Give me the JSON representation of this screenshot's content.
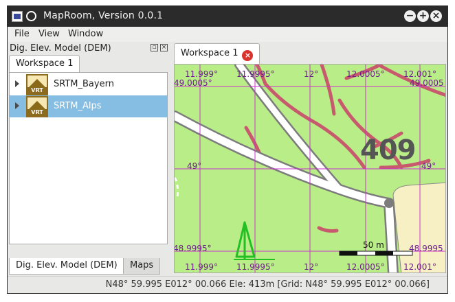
{
  "window": {
    "title": "MapRoom, Version 0.0.1",
    "buttons": [
      "−",
      "+",
      "×"
    ]
  },
  "menu": [
    "File",
    "View",
    "Window"
  ],
  "layers_panel": {
    "title": "Dig. Elev. Model (DEM)",
    "tab": "Workspace 1",
    "layers": [
      {
        "label": "SRTM_Bayern",
        "icon_text": "VRT",
        "selected": false
      },
      {
        "label": "SRTM_Alps",
        "icon_text": "VRT",
        "selected": true
      }
    ],
    "bottom_tabs": [
      "Dig. Elev. Model (DEM)",
      "Maps"
    ]
  },
  "workspace": {
    "tab": "Workspace 1",
    "close_symbol": "×",
    "grid_labels": {
      "top": [
        "11.999°",
        "11.9995°",
        "12°",
        "12.0005°",
        "12.001°"
      ],
      "bottom": [
        "11.999°",
        "11.9995°",
        "12°",
        "12.0005°",
        "12.001°"
      ],
      "left": [
        "49.0005°",
        "49°",
        "48.9995°"
      ],
      "right": [
        "49.0005",
        "49°",
        "48.9995"
      ]
    },
    "elevation_label": "409",
    "scale_label": "50 m"
  },
  "status": "N48° 59.995 E012° 00.066 Ele: 413m [Grid: N48° 59.995 E012° 00.066]",
  "colors": {
    "terrain": "#b9ed87",
    "grid": "#cc33cc",
    "contour": "#c85a6e",
    "road": "#7c7c7c",
    "selection": "#86bde3"
  }
}
